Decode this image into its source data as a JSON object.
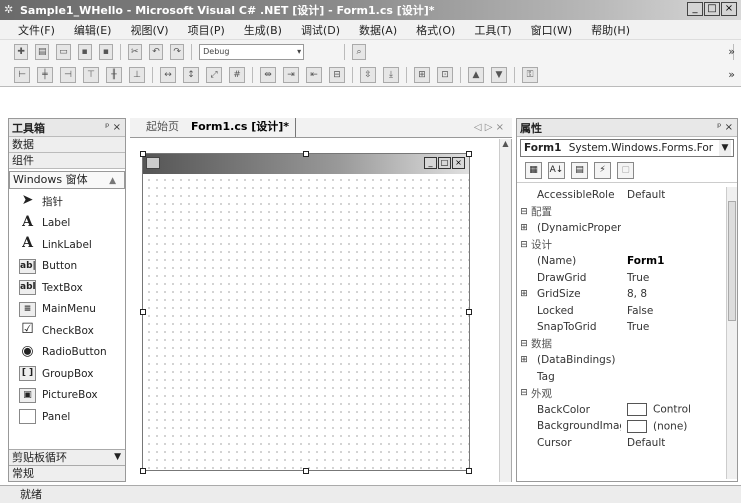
{
  "window": {
    "title": "Sample1_WHello - Microsoft Visual C# .NET [设计] - Form1.cs [设计]*",
    "buttons": [
      "_",
      "□",
      "×"
    ]
  },
  "menu": [
    "文件(F)",
    "编辑(E)",
    "视图(V)",
    "项目(P)",
    "生成(B)",
    "调试(D)",
    "数据(A)",
    "格式(O)",
    "工具(T)",
    "窗口(W)",
    "帮助(H)"
  ],
  "toolbar": {
    "config_combo": "Debug"
  },
  "toolbox": {
    "title": "工具箱",
    "pin": "ᵖ ×",
    "categories": [
      "数据",
      "组件"
    ],
    "group": "Windows 窗体",
    "items": [
      {
        "icon": "pointer-icon",
        "glyph": "➤",
        "label": "指针"
      },
      {
        "icon": "label-icon",
        "glyph": "A",
        "label": "Label"
      },
      {
        "icon": "linklabel-icon",
        "glyph": "A",
        "label": "LinkLabel"
      },
      {
        "icon": "button-icon",
        "glyph": "ab|",
        "label": "Button"
      },
      {
        "icon": "textbox-icon",
        "glyph": "abl",
        "label": "TextBox"
      },
      {
        "icon": "mainmenu-icon",
        "glyph": "≡",
        "label": "MainMenu"
      },
      {
        "icon": "checkbox-icon",
        "glyph": "☑",
        "label": "CheckBox"
      },
      {
        "icon": "radiobutton-icon",
        "glyph": "◉",
        "label": "RadioButton"
      },
      {
        "icon": "groupbox-icon",
        "glyph": "[ ]",
        "label": "GroupBox"
      },
      {
        "icon": "picturebox-icon",
        "glyph": "▣",
        "label": "PictureBox"
      },
      {
        "icon": "panel-icon",
        "glyph": "",
        "label": "Panel"
      }
    ],
    "bottom": [
      "剪贴板循环",
      "常规"
    ]
  },
  "document": {
    "tabs": [
      "起始页",
      "Form1.cs [设计]*"
    ],
    "nav": "◁ ▷ ×"
  },
  "properties": {
    "title": "属性",
    "pin": "ᵖ ×",
    "object_name": "Form1",
    "object_type": "System.Windows.Forms.For",
    "rows": [
      {
        "kind": "prop",
        "name": "AccessibleRole",
        "value": "Default"
      },
      {
        "kind": "cat",
        "exp": "⊟",
        "name": "配置"
      },
      {
        "kind": "prop",
        "exp": "⊞",
        "name": "(DynamicPropert",
        "value": ""
      },
      {
        "kind": "cat",
        "exp": "⊟",
        "name": "设计"
      },
      {
        "kind": "prop",
        "name": "(Name)",
        "value": "Form1",
        "bold": true
      },
      {
        "kind": "prop",
        "name": "DrawGrid",
        "value": "True"
      },
      {
        "kind": "prop",
        "exp": "⊞",
        "name": "GridSize",
        "value": "8, 8"
      },
      {
        "kind": "prop",
        "name": "Locked",
        "value": "False"
      },
      {
        "kind": "prop",
        "name": "SnapToGrid",
        "value": "True"
      },
      {
        "kind": "cat",
        "exp": "⊟",
        "name": "数据"
      },
      {
        "kind": "prop",
        "exp": "⊞",
        "name": "(DataBindings)",
        "value": ""
      },
      {
        "kind": "prop",
        "name": "Tag",
        "value": ""
      },
      {
        "kind": "cat",
        "exp": "⊟",
        "name": "外观"
      },
      {
        "kind": "prop",
        "name": "BackColor",
        "value": "Control",
        "swatch": true
      },
      {
        "kind": "prop",
        "name": "BackgroundImag",
        "value": "(none)",
        "swatch": true
      },
      {
        "kind": "prop",
        "name": "Cursor",
        "value": "Default"
      }
    ]
  },
  "status": "就绪"
}
